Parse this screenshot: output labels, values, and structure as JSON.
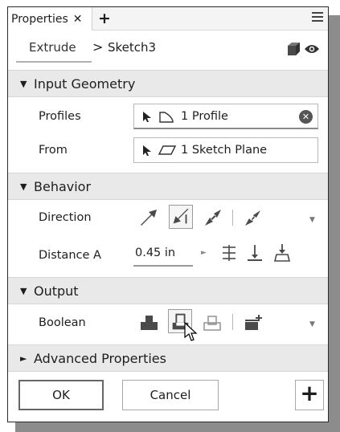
{
  "tab": {
    "title": "Properties",
    "close": "✕",
    "add": "+"
  },
  "breadcrumb": {
    "feature": "Extrude",
    "separator": ">",
    "sketch": "Sketch3"
  },
  "sections": {
    "input_geometry": {
      "title": "Input Geometry",
      "expanded": true
    },
    "behavior": {
      "title": "Behavior",
      "expanded": true
    },
    "output": {
      "title": "Output",
      "expanded": true
    },
    "advanced": {
      "title": "Advanced Properties",
      "expanded": false
    }
  },
  "input_geometry": {
    "profiles_label": "Profiles",
    "profiles_value": "1 Profile",
    "from_label": "From",
    "from_value": "1 Sketch Plane"
  },
  "behavior": {
    "direction_label": "Direction",
    "direction_options": [
      "direction-default-icon",
      "direction-flipped-icon",
      "direction-symmetric-icon",
      "direction-asymmetric-icon"
    ],
    "direction_selected": "direction-flipped-icon",
    "distance_label": "Distance A",
    "distance_value": "0.45 in",
    "extent_options": [
      "distance-icon",
      "to-next-icon",
      "to-icon"
    ]
  },
  "output": {
    "boolean_label": "Boolean",
    "boolean_options": [
      "join-icon",
      "cut-icon",
      "intersect-icon",
      "new-solid-icon"
    ],
    "boolean_selected": "cut-icon"
  },
  "buttons": {
    "ok": "OK",
    "cancel": "Cancel",
    "add": "+"
  },
  "colors": {
    "section_bg": "#e9e9e9",
    "icon_gray": "#4a4a4a",
    "selected_border": "#9a9a9a"
  }
}
